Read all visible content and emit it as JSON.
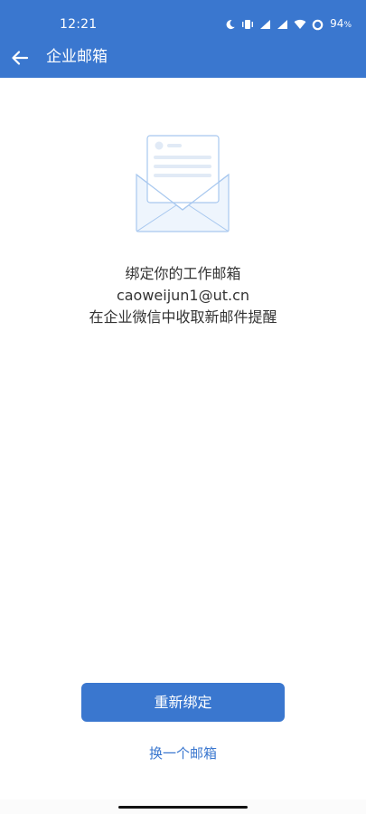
{
  "status_bar": {
    "time": "12:21",
    "battery_percent": "94",
    "battery_unit": "%",
    "icons": [
      "moon-icon",
      "vibrate-icon",
      "signal-icon",
      "signal-icon",
      "wifi-icon",
      "battery-ring-icon"
    ]
  },
  "header": {
    "title": "企业邮箱",
    "back_icon": "arrow-left-icon"
  },
  "illustration": {
    "icon": "envelope-letter-icon"
  },
  "message": {
    "line1": "绑定你的工作邮箱",
    "email": "caoweijun1@ut.cn",
    "line3": "在企业微信中收取新邮件提醒"
  },
  "actions": {
    "rebind_label": "重新绑定",
    "change_mailbox_label": "换一个邮箱"
  },
  "colors": {
    "brand_blue": "#3a77cf",
    "text_primary": "#333333",
    "background": "#ffffff",
    "illustration_stroke": "#a8c8ef",
    "illustration_fill": "#eef5fd"
  }
}
